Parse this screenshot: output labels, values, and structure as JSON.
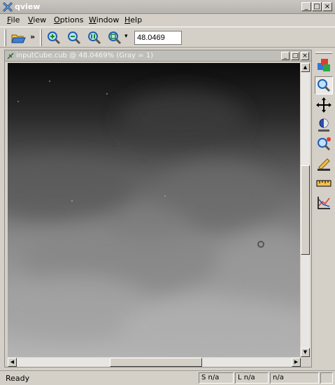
{
  "window": {
    "title": "qview",
    "minimize": "_",
    "maximize": "□",
    "close": "×"
  },
  "menu": [
    {
      "label": "File",
      "u": "F",
      "rest": "ile"
    },
    {
      "label": "View",
      "u": "V",
      "rest": "iew"
    },
    {
      "label": "Options",
      "u": "O",
      "rest": "ptions"
    },
    {
      "label": "Window",
      "u": "W",
      "rest": "indow"
    },
    {
      "label": "Help",
      "u": "H",
      "rest": "elp"
    }
  ],
  "toolbar": {
    "overflow_glyph": "»",
    "zoom_value": "48.0469"
  },
  "subwindow": {
    "title": "inputCube.cub @ 48.0469% (Gray = 1)"
  },
  "statusbar": {
    "message": "Ready",
    "sample": "S n/a",
    "line": "L n/a",
    "value": "n/a",
    "extra": ""
  },
  "colors": {
    "title_bg": "#b8b6b0",
    "chrome": "#d4d0c8",
    "accent_blue": "#3c7fd6"
  },
  "icons": {
    "toolbar": [
      "open-file-icon",
      "zoom-in-icon",
      "zoom-out-icon",
      "zoom-actual-icon",
      "zoom-fit-icon"
    ],
    "right_tools": [
      "band-select-icon",
      "zoom-tool-icon",
      "pan-tool-icon",
      "stretch-tool-icon",
      "find-tool-icon",
      "edit-tool-icon",
      "measure-tool-icon",
      "plot-tool-icon"
    ]
  }
}
